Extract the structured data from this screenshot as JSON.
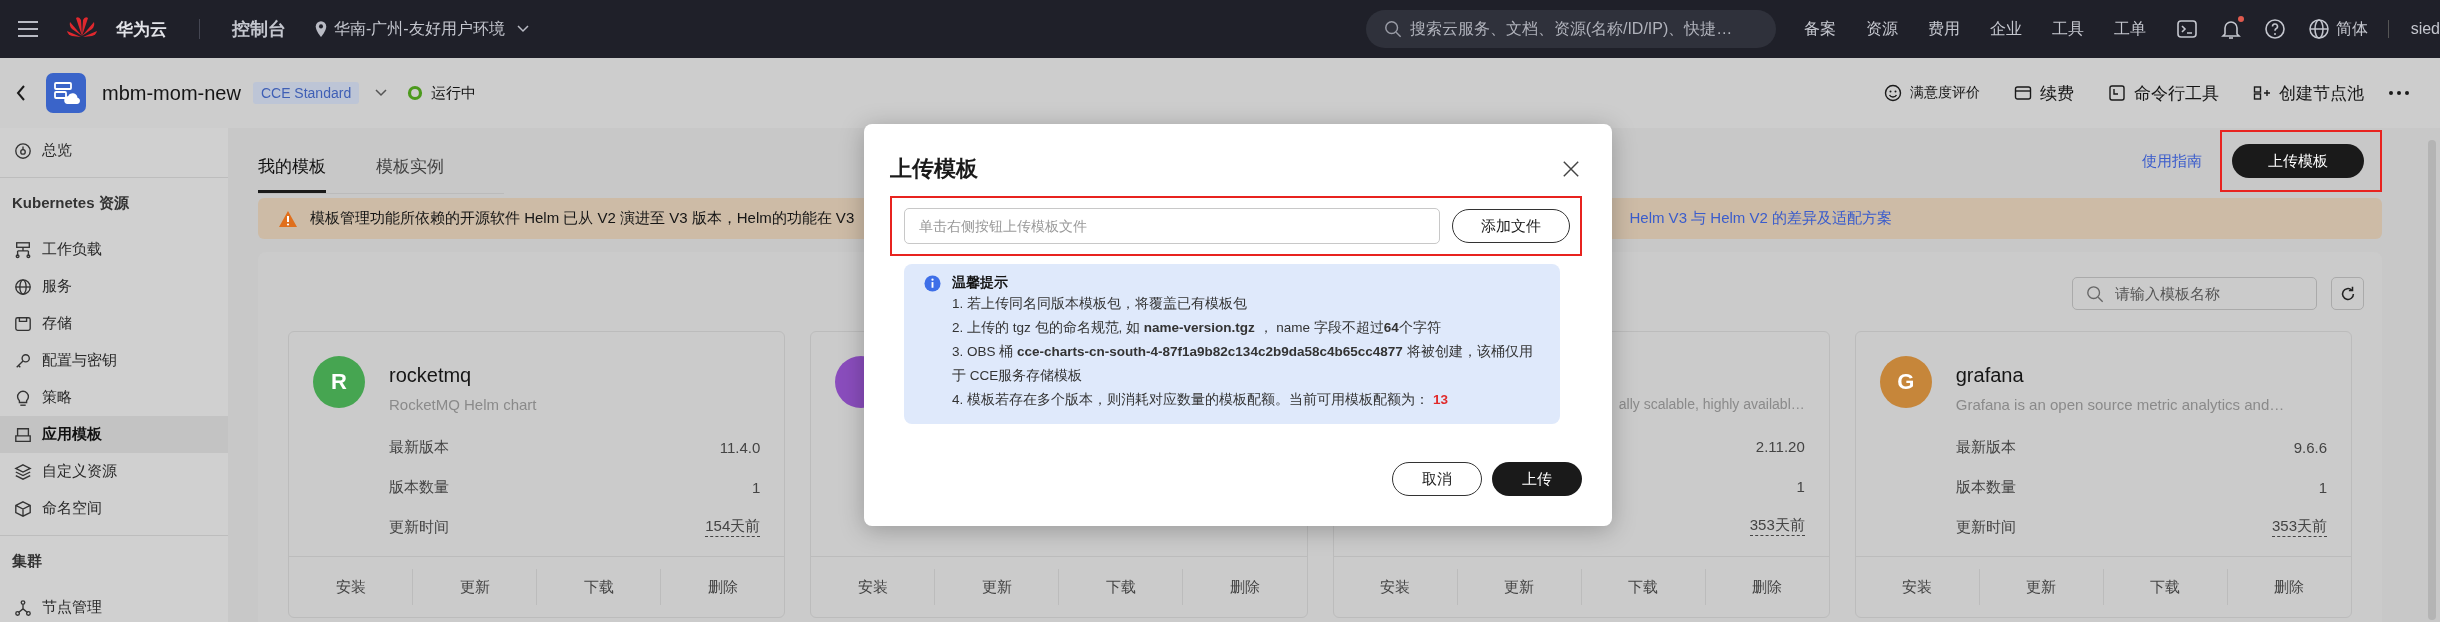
{
  "topbar": {
    "brand": "华为云",
    "console": "控制台",
    "region": "华南-广州-友好用户环境",
    "search": {
      "placeholder": "搜索云服务、文档、资源(名称/ID/IP)、快捷…"
    },
    "nav": [
      "备案",
      "资源",
      "费用",
      "企业",
      "工具",
      "工单"
    ],
    "notification_dot": true,
    "language": "简体",
    "user": "sied"
  },
  "cluster_bar": {
    "name": "mbm-mom-new",
    "tag": "CCE Standard",
    "status": "运行中",
    "actions": [
      "满意度评价",
      "续费",
      "命令行工具",
      "创建节点池"
    ]
  },
  "sidebar": {
    "sections": [
      {
        "items": [
          {
            "label": "总览",
            "selected": false
          }
        ]
      },
      {
        "heading": "Kubernetes 资源",
        "items": [
          {
            "label": "工作负载",
            "selected": false
          },
          {
            "label": "服务",
            "selected": false
          },
          {
            "label": "存储",
            "selected": false
          },
          {
            "label": "配置与密钥",
            "selected": false
          },
          {
            "label": "策略",
            "selected": false
          },
          {
            "label": "应用模板",
            "selected": true
          },
          {
            "label": "自定义资源",
            "selected": false
          },
          {
            "label": "命名空间",
            "selected": false
          }
        ]
      },
      {
        "heading": "集群",
        "items": [
          {
            "label": "节点管理",
            "selected": false
          }
        ]
      }
    ]
  },
  "tabs": [
    {
      "label": "我的模板",
      "selected": true
    },
    {
      "label": "模板实例",
      "selected": false
    }
  ],
  "guide_link": "使用指南",
  "upload_button": "上传模板",
  "banner": {
    "text": "模板管理功能所依赖的开源软件 Helm 已从 V2 演进至 V3 版本，Helm的功能在 V3",
    "link": "Helm V3 与 Helm V2 的差异及适配方案"
  },
  "template_search": {
    "placeholder": "请输入模板名称"
  },
  "cards": [
    {
      "initial": "R",
      "color": "#46a551",
      "name": "rocketmq",
      "description": "RocketMQ Helm chart",
      "rows": [
        {
          "label": "最新版本",
          "value": "11.4.0"
        },
        {
          "label": "版本数量",
          "value": "1"
        },
        {
          "label": "更新时间",
          "value": "154天前"
        }
      ],
      "actions": [
        "安装",
        "更新",
        "下载",
        "删除"
      ]
    },
    {
      "color": "#8a4dbd",
      "actions": [
        "安装",
        "更新",
        "下载",
        "删除"
      ]
    },
    {
      "description": "ally scalable, highly availabl…",
      "rows": [
        {
          "value": "2.11.20"
        },
        {
          "value": "1"
        },
        {
          "value": "353天前"
        }
      ],
      "actions": [
        "安装",
        "更新",
        "下载",
        "删除"
      ]
    },
    {
      "initial": "G",
      "color": "#c6863a",
      "name": "grafana",
      "description": "Grafana is an open source metric analytics and…",
      "rows": [
        {
          "label": "最新版本",
          "value": "9.6.6"
        },
        {
          "label": "版本数量",
          "value": "1"
        },
        {
          "label": "更新时间",
          "value": "353天前"
        }
      ],
      "actions": [
        "安装",
        "更新",
        "下载",
        "删除"
      ]
    }
  ],
  "dialog": {
    "title": "上传模板",
    "file_field": {
      "placeholder": "单击右侧按钮上传模板文件"
    },
    "add_button": "添加文件",
    "tip_title": "温馨提示",
    "tips": [
      "1. 若上传同名同版本模板包，将覆盖已有模板包",
      "2. 上传的 tgz 包的命名规范, 如 **name-version.tgz** ， name 字段不超过**64**个字符",
      "3. OBS 桶 **cce-charts-cn-south-4-87f1a9b82c134c2b9da58c4b65cc4877** 将被创建，该桶仅用于 CCE服务存储模板",
      "4. 模板若存在多个版本，则消耗对应数量的模板配额。当前可用模板配额为："
    ],
    "quota": "13",
    "cancel_button": "取消",
    "confirm_button": "上传"
  }
}
